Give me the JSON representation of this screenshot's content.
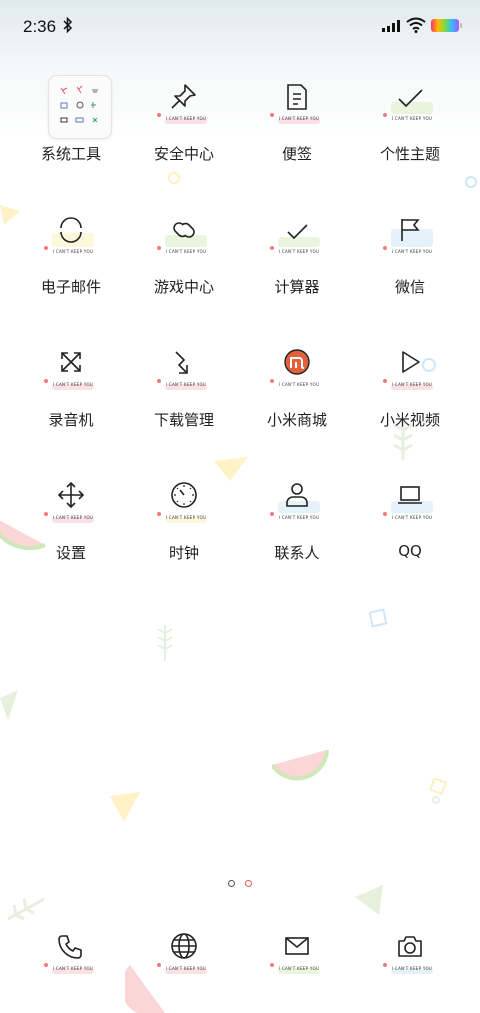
{
  "status_bar": {
    "time": "2:36"
  },
  "tagline": "I CAN'T KEEP YOU",
  "apps": [
    {
      "label": "系统工具",
      "icon": "folder-icon"
    },
    {
      "label": "安全中心",
      "icon": "pin-icon"
    },
    {
      "label": "便签",
      "icon": "note-icon"
    },
    {
      "label": "个性主题",
      "icon": "check-icon"
    },
    {
      "label": "电子邮件",
      "icon": "circle-arc-icon"
    },
    {
      "label": "游戏中心",
      "icon": "link-icon"
    },
    {
      "label": "计算器",
      "icon": "check-icon"
    },
    {
      "label": "微信",
      "icon": "flag-icon"
    },
    {
      "label": "录音机",
      "icon": "expand-icon"
    },
    {
      "label": "下载管理",
      "icon": "arrow-curve-icon"
    },
    {
      "label": "小米商城",
      "icon": "mi-store-icon"
    },
    {
      "label": "小米视频",
      "icon": "play-icon"
    },
    {
      "label": "设置",
      "icon": "move-arrows-icon"
    },
    {
      "label": "时钟",
      "icon": "clock-icon"
    },
    {
      "label": "联系人",
      "icon": "person-icon"
    },
    {
      "label": "QQ",
      "icon": "laptop-icon"
    }
  ],
  "dock": [
    {
      "icon": "phone-icon"
    },
    {
      "icon": "globe-icon"
    },
    {
      "icon": "mail-icon"
    },
    {
      "icon": "camera-icon"
    }
  ],
  "colors": {
    "accent": "#e05a5a",
    "stroke_pink": "#f6c9d2",
    "stroke_green": "#d8ecc2",
    "stroke_blue": "#cfe7f5"
  }
}
